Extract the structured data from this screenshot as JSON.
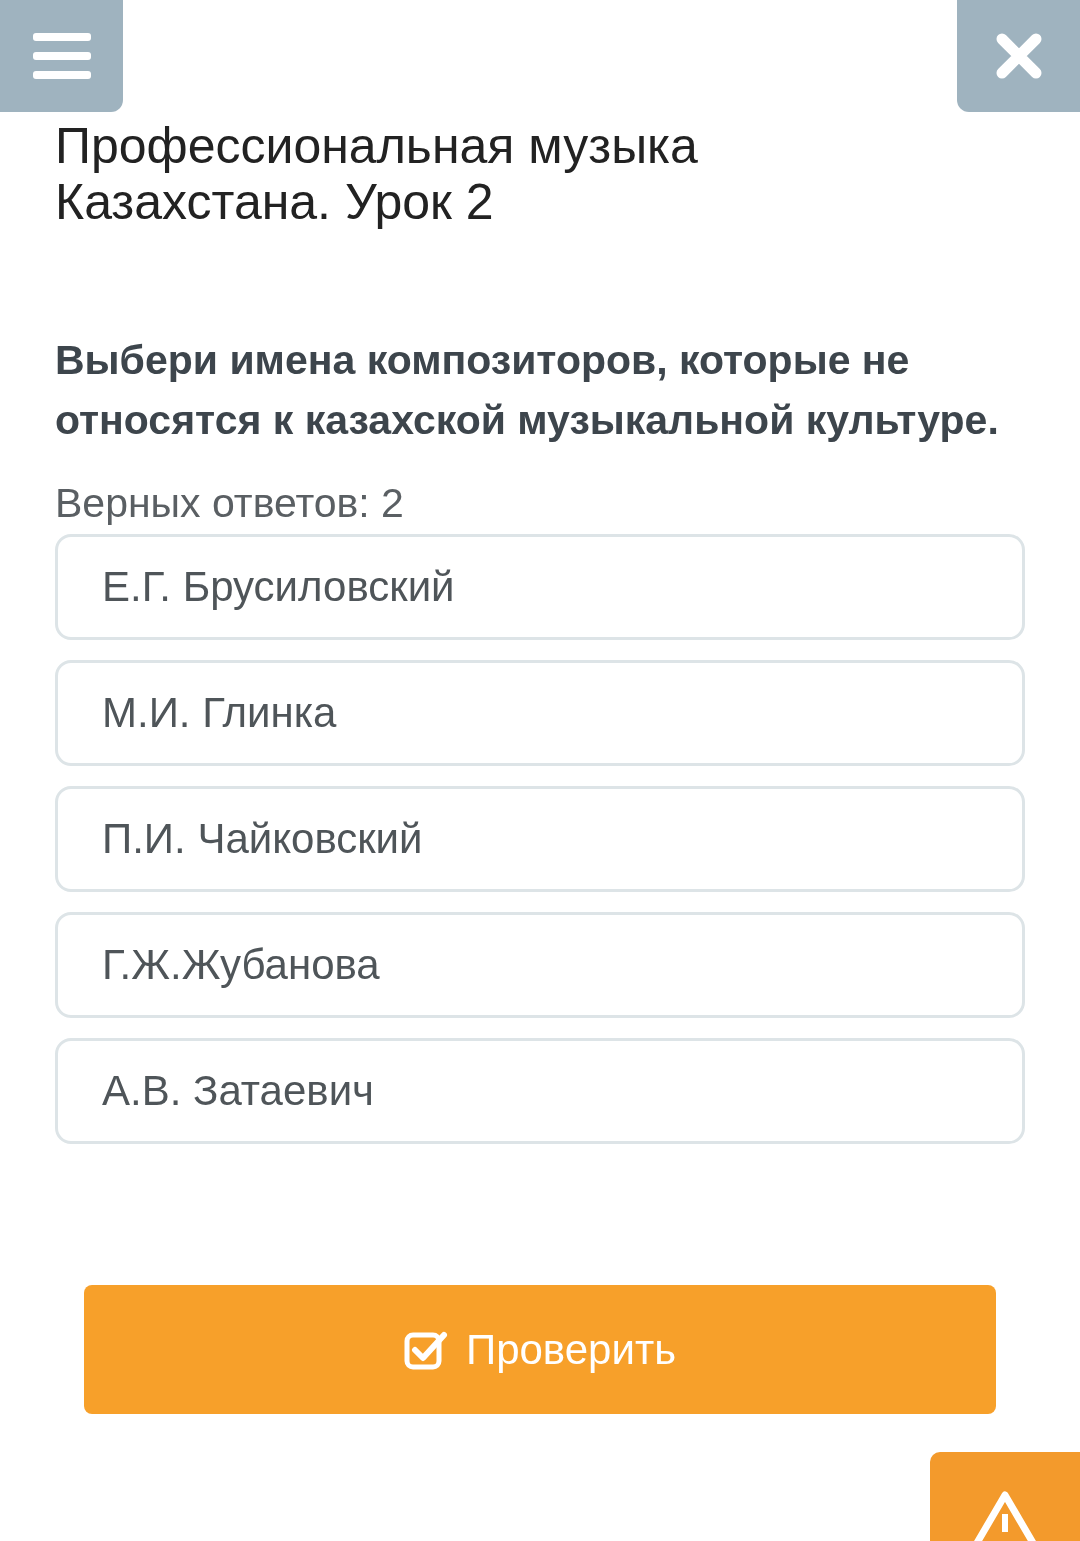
{
  "title": "Профессиональная музыка Казахстана. Урок 2",
  "question": "Выбери имена композиторов, которые не относятся к казахской музыкальной культуре.",
  "answers_count": "Верных ответов: 2",
  "options": [
    {
      "label": "Е.Г. Брусиловский",
      "selected": false
    },
    {
      "label": "М.И. Глинка",
      "selected": false
    },
    {
      "label": "П.И. Чайковский",
      "selected": false
    },
    {
      "label": "Г.Ж.Жубанова",
      "selected": false
    },
    {
      "label": "А.В. Затаевич",
      "selected": false
    }
  ],
  "check_button": "Проверить"
}
